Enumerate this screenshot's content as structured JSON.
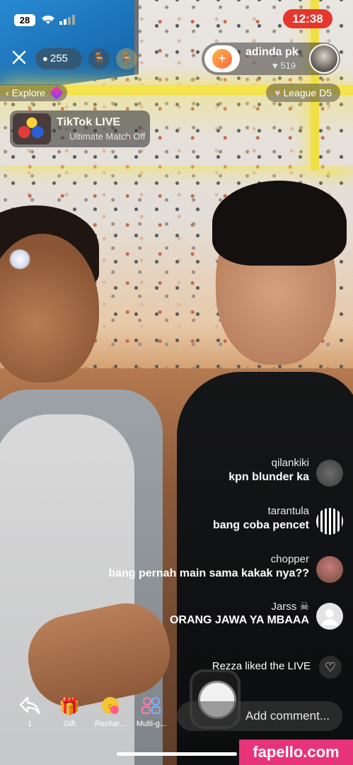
{
  "status_bar": {
    "battery": "28",
    "time": "12:38"
  },
  "top_bar": {
    "viewer_count": "255",
    "host": {
      "name": "adinda pk",
      "likes": "519"
    },
    "league": "League D5",
    "explore": "Explore"
  },
  "event_banner": {
    "title": "TikTok LIVE",
    "subtitle": "Ultimate Match Off"
  },
  "comments": [
    {
      "user": "qilankiki",
      "text": "kpn blunder ka"
    },
    {
      "user": "tarantula",
      "text": "bang coba pencet"
    },
    {
      "user": "chopper",
      "text": "bang pernah main sama kakak nya??"
    },
    {
      "user": "Jarss",
      "text": "ORANG JAWA YA MBAAA"
    }
  ],
  "like_notice": "Rezza liked the LIVE",
  "bottom_bar": {
    "comment_placeholder": "Add comment...",
    "tools": [
      {
        "label": "Multi-g...",
        "icon": "multi-guest-icon"
      },
      {
        "label": "Rechar...",
        "icon": "recharge-icon"
      },
      {
        "label": "Gift",
        "icon": "gift-icon"
      },
      {
        "label": "1",
        "icon": "share-icon"
      }
    ]
  },
  "watermark": "fapello.com"
}
